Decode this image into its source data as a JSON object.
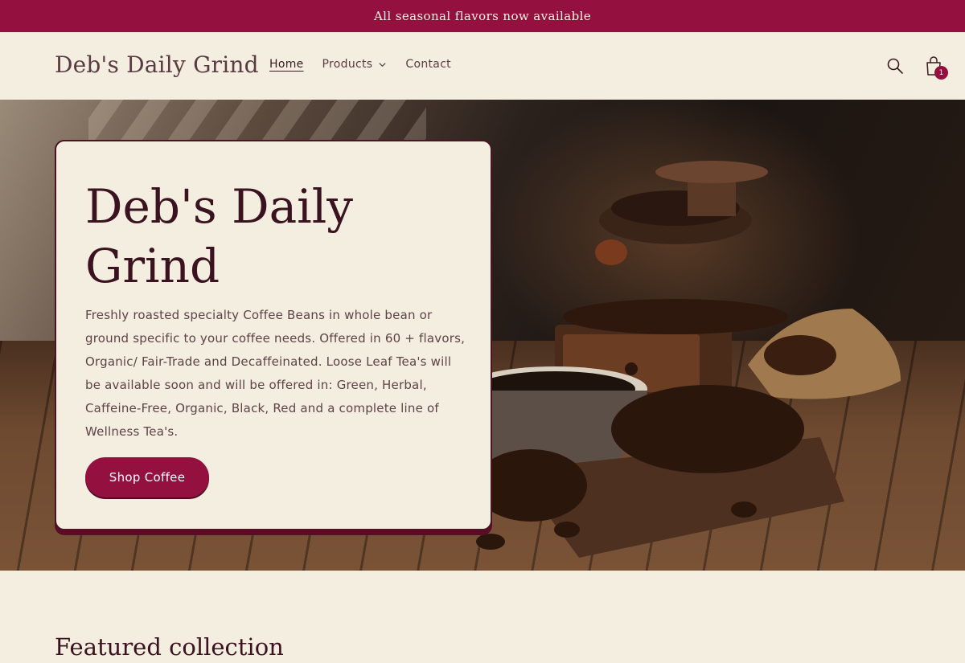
{
  "announcement": {
    "text": "All seasonal flavors now available"
  },
  "header": {
    "logo": "Deb's Daily Grind",
    "nav": [
      {
        "label": "Home",
        "active": true
      },
      {
        "label": "Products",
        "has_dropdown": true
      },
      {
        "label": "Contact"
      }
    ],
    "icons": {
      "search": "search-icon",
      "cart": "cart-icon"
    },
    "cart_count": "1"
  },
  "hero": {
    "title": "Deb's Daily Grind",
    "description": "Freshly roasted specialty Coffee Beans in whole bean or ground specific to your coffee needs. Offered in 60 + flavors, Organic/ Fair-Trade and Decaffeinated. Loose Leaf Tea's will be available soon and will be offered in: Green, Herbal, Caffeine-Free, Organic, Black, Red and a complete line of Wellness Tea's.",
    "button_label": "Shop Coffee"
  },
  "featured": {
    "title": "Featured collection"
  },
  "colors": {
    "brand": "#93103f",
    "background": "#f3eedf",
    "text": "#3a1220"
  }
}
